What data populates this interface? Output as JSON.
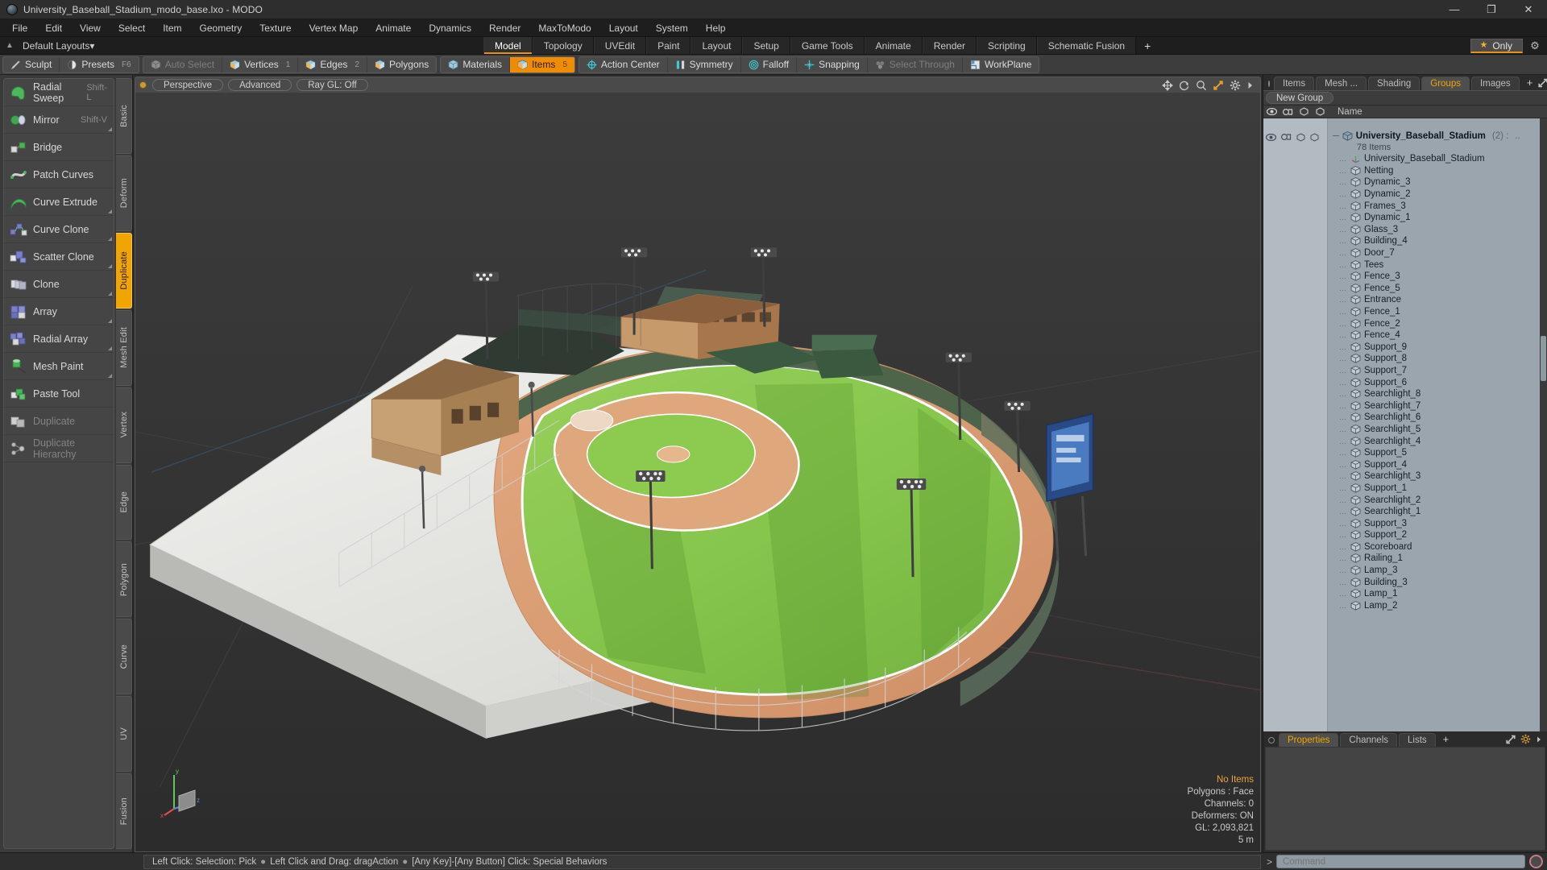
{
  "titlebar": {
    "title": "University_Baseball_Stadium_modo_base.lxo - MODO",
    "minimize": "—",
    "maximize": "❐",
    "close": "✕"
  },
  "menubar": {
    "items": [
      "File",
      "Edit",
      "View",
      "Select",
      "Item",
      "Geometry",
      "Texture",
      "Vertex Map",
      "Animate",
      "Dynamics",
      "Render",
      "MaxToModo",
      "Layout",
      "System",
      "Help"
    ]
  },
  "layoutbar": {
    "layouts_label": "Default Layouts",
    "layouts_caret": "▾",
    "tabs": [
      {
        "label": "Model",
        "active": true
      },
      {
        "label": "Topology",
        "active": false
      },
      {
        "label": "UVEdit",
        "active": false
      },
      {
        "label": "Paint",
        "active": false
      },
      {
        "label": "Layout",
        "active": false
      },
      {
        "label": "Setup",
        "active": false
      },
      {
        "label": "Game Tools",
        "active": false
      },
      {
        "label": "Animate",
        "active": false
      },
      {
        "label": "Render",
        "active": false
      },
      {
        "label": "Scripting",
        "active": false
      },
      {
        "label": "Schematic Fusion",
        "active": false
      }
    ],
    "add_tab": "+",
    "only_label": "Only",
    "star_icon": "★",
    "gear_icon": "⚙"
  },
  "modebar": {
    "group_left": [
      {
        "label": "Sculpt",
        "icon": "sculpt-icon",
        "num": "",
        "state": "normal"
      },
      {
        "label": "Presets",
        "icon": "presets-icon",
        "num": "F6",
        "state": "normal"
      }
    ],
    "group_select": [
      {
        "label": "Auto Select",
        "icon": "auto-select-icon",
        "num": "",
        "state": "dim"
      },
      {
        "label": "Vertices",
        "icon": "vertices-icon",
        "num": "1",
        "state": "normal"
      },
      {
        "label": "Edges",
        "icon": "edges-icon",
        "num": "2",
        "state": "normal"
      },
      {
        "label": "Polygons",
        "icon": "polygons-icon",
        "num": "",
        "state": "normal"
      }
    ],
    "group_items": [
      {
        "label": "Materials",
        "icon": "materials-icon",
        "num": "",
        "state": "normal"
      },
      {
        "label": "Items",
        "icon": "items-icon",
        "num": "5",
        "state": "selected"
      }
    ],
    "group_tools": [
      {
        "label": "Action Center",
        "icon": "action-center-icon",
        "num": "",
        "state": "normal"
      },
      {
        "label": "Symmetry",
        "icon": "symmetry-icon",
        "num": "",
        "state": "normal"
      },
      {
        "label": "Falloff",
        "icon": "falloff-icon",
        "num": "",
        "state": "normal"
      },
      {
        "label": "Snapping",
        "icon": "snapping-icon",
        "num": "",
        "state": "normal"
      },
      {
        "label": "Select Through",
        "icon": "select-through-icon",
        "num": "",
        "state": "dim"
      },
      {
        "label": "WorkPlane",
        "icon": "workplane-icon",
        "num": "",
        "state": "normal"
      }
    ]
  },
  "tools_panel": {
    "items": [
      {
        "label": "Radial Sweep",
        "shortcut": "Shift-L",
        "dim": false,
        "corner": false
      },
      {
        "label": "Mirror",
        "shortcut": "Shift-V",
        "dim": false,
        "corner": true
      },
      {
        "label": "Bridge",
        "shortcut": "",
        "dim": false,
        "corner": false
      },
      {
        "label": "Patch Curves",
        "shortcut": "",
        "dim": false,
        "corner": false
      },
      {
        "label": "Curve Extrude",
        "shortcut": "",
        "dim": false,
        "corner": true
      },
      {
        "label": "Curve Clone",
        "shortcut": "",
        "dim": false,
        "corner": true
      },
      {
        "label": "Scatter Clone",
        "shortcut": "",
        "dim": false,
        "corner": true
      },
      {
        "label": "Clone",
        "shortcut": "",
        "dim": false,
        "corner": true
      },
      {
        "label": "Array",
        "shortcut": "",
        "dim": false,
        "corner": true
      },
      {
        "label": "Radial Array",
        "shortcut": "",
        "dim": false,
        "corner": true
      },
      {
        "label": "Mesh Paint",
        "shortcut": "",
        "dim": false,
        "corner": true
      },
      {
        "label": "Paste Tool",
        "shortcut": "",
        "dim": false,
        "corner": false
      },
      {
        "label": "Duplicate",
        "shortcut": "",
        "dim": true,
        "corner": false
      },
      {
        "label": "Duplicate Hierarchy",
        "shortcut": "",
        "dim": true,
        "corner": false
      }
    ],
    "vertical_tabs": [
      {
        "label": "Basic",
        "active": false
      },
      {
        "label": "Deform",
        "active": false
      },
      {
        "label": "Duplicate",
        "active": true
      },
      {
        "label": "Mesh Edit",
        "active": false
      },
      {
        "label": "Vertex",
        "active": false
      },
      {
        "label": "Edge",
        "active": false
      },
      {
        "label": "Polygon",
        "active": false
      },
      {
        "label": "Curve",
        "active": false
      },
      {
        "label": "UV",
        "active": false
      },
      {
        "label": "Fusion",
        "active": false
      }
    ]
  },
  "viewport": {
    "pills": [
      "Perspective",
      "Advanced",
      "Ray GL: Off"
    ],
    "tool_icons": [
      "move-icon",
      "rotate-icon",
      "zoom-icon",
      "fit-icon",
      "gear-icon",
      "chevron-right-icon"
    ],
    "info": {
      "no_items": "No Items",
      "polygons": "Polygons : Face",
      "channels": "Channels: 0",
      "deformers": "Deformers: ON",
      "gl": "GL: 2,093,821",
      "scale": "5 m"
    },
    "axis": {
      "x": "x",
      "y": "y",
      "z": "z"
    }
  },
  "right_panel": {
    "tabs": [
      {
        "label": "Items",
        "active": false
      },
      {
        "label": "Mesh ...",
        "active": false
      },
      {
        "label": "Shading",
        "active": false
      },
      {
        "label": "Groups",
        "active": true
      },
      {
        "label": "Images",
        "active": false
      }
    ],
    "add_tab": "+",
    "new_group_label": "New Group",
    "tree_header": {
      "name": "Name"
    },
    "group": {
      "name": "University_Baseball_Stadium",
      "count": "(2) :",
      "items_count": "78 Items"
    },
    "items": [
      "University_Baseball_Stadium",
      "Netting",
      "Dynamic_3",
      "Dynamic_2",
      "Frames_3",
      "Dynamic_1",
      "Glass_3",
      "Building_4",
      "Door_7",
      "Tees",
      "Fence_3",
      "Fence_5",
      "Entrance",
      "Fence_1",
      "Fence_2",
      "Fence_4",
      "Support_9",
      "Support_8",
      "Support_7",
      "Support_6",
      "Searchlight_8",
      "Searchlight_7",
      "Searchlight_6",
      "Searchlight_5",
      "Searchlight_4",
      "Support_5",
      "Support_4",
      "Searchlight_3",
      "Support_1",
      "Searchlight_2",
      "Searchlight_1",
      "Support_3",
      "Support_2",
      "Scoreboard",
      "Railing_1",
      "Lamp_3",
      "Building_3",
      "Lamp_1",
      "Lamp_2"
    ]
  },
  "properties_panel": {
    "tabs": [
      {
        "label": "Properties",
        "active": true
      },
      {
        "label": "Channels",
        "active": false
      },
      {
        "label": "Lists",
        "active": false
      }
    ],
    "add_tab": "+"
  },
  "statusbar": {
    "hints": [
      "Left Click: Selection: Pick",
      "Left Click and Drag: dragAction",
      "[Any Key]-[Any Button] Click: Special Behaviors"
    ],
    "separator": "●",
    "command_prompt": ">",
    "command_placeholder": "Command"
  },
  "colors": {
    "accent": "#f0a500",
    "selected": "#f08c00",
    "tree_bg": "#9aa5ad",
    "grass": "#7ec24b",
    "dirt": "#d89a6e"
  }
}
